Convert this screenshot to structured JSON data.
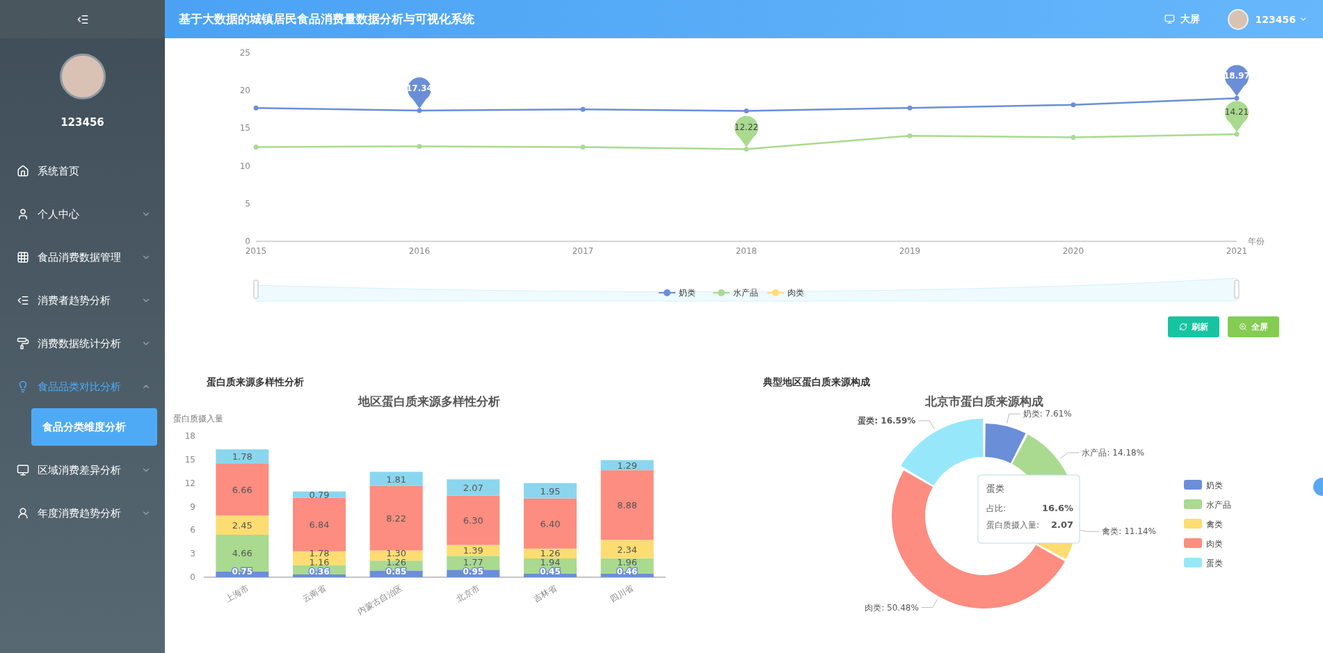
{
  "header": {
    "title": "基于大数据的城镇居民食品消费量数据分析与可视化系统",
    "screen_button": "大屏",
    "user": "123456"
  },
  "sidebar": {
    "username": "123456",
    "items": [
      {
        "label": "系统首页",
        "kind": "link",
        "selected": false
      },
      {
        "label": "个人中心",
        "kind": "submenu",
        "expanded": false,
        "selected": false
      },
      {
        "label": "食品消费数据管理",
        "kind": "submenu",
        "expanded": false,
        "selected": false
      },
      {
        "label": "消费者趋势分析",
        "kind": "submenu",
        "expanded": false,
        "selected": false
      },
      {
        "label": "消费数据统计分析",
        "kind": "submenu",
        "expanded": false,
        "selected": false
      },
      {
        "label": "食品品类对比分析",
        "kind": "submenu",
        "expanded": true,
        "selected": true,
        "children": [
          {
            "label": "食品分类维度分析",
            "selected": true
          }
        ]
      },
      {
        "label": "区域消费差异分析",
        "kind": "submenu",
        "expanded": false,
        "selected": false
      },
      {
        "label": "年度消费趋势分析",
        "kind": "submenu",
        "expanded": false,
        "selected": false
      }
    ]
  },
  "trend_chart": {
    "chart_data": {
      "type": "line",
      "xlabel": "年份",
      "x": [
        "2015",
        "2016",
        "2017",
        "2018",
        "2019",
        "2020",
        "2021"
      ],
      "yticks": [
        0,
        5,
        10,
        15,
        20,
        25
      ],
      "ylim": [
        0,
        25
      ],
      "legend": "bottom",
      "series": [
        {
          "name": "奶类",
          "color": "#6b8ed8",
          "marker": "circle",
          "values": [
            17.7,
            17.34,
            17.5,
            17.3,
            17.7,
            18.1,
            18.97
          ]
        },
        {
          "name": "水产品",
          "color": "#a9da8f",
          "marker": "circle",
          "values": [
            12.5,
            12.6,
            12.5,
            12.22,
            14.0,
            13.8,
            14.21
          ]
        },
        {
          "name": "肉类",
          "color": "#fddd80",
          "marker": "circle",
          "values": [
            null,
            null,
            null,
            null,
            null,
            null,
            null
          ]
        }
      ],
      "annotations": [
        {
          "x": "2016",
          "y": 17.34,
          "text": "17.34"
        },
        {
          "x": "2021",
          "y": 18.97,
          "text": "18.97"
        },
        {
          "x": "2018",
          "y": 12.22,
          "text": "12.22"
        },
        {
          "x": "2021",
          "y": 14.21,
          "text": "14.21"
        }
      ]
    },
    "buttons": [
      {
        "label": "刷新",
        "kind": "refresh"
      },
      {
        "label": "全屏",
        "kind": "fullscreen"
      }
    ]
  },
  "diversity": {
    "heading": "蛋白质来源多样性分析",
    "chart_data": {
      "type": "bar",
      "stacked": true,
      "title": "地区蛋白质来源多样性分析",
      "ylabel": "蛋白质摄入量",
      "yticks": [
        0,
        3,
        6,
        9,
        12,
        15,
        18
      ],
      "ylim": [
        0,
        18
      ],
      "categories": [
        "上海市",
        "云南省",
        "内蒙古自治区",
        "北京市",
        "吉林省",
        "四川省"
      ],
      "series": [
        {
          "color": "#6b8ed8",
          "values": [
            0.75,
            0.36,
            0.85,
            0.95,
            0.45,
            0.46
          ]
        },
        {
          "color": "#a9da8f",
          "values": [
            4.66,
            1.16,
            1.26,
            1.77,
            1.94,
            1.96
          ]
        },
        {
          "color": "#fddd72",
          "values": [
            2.45,
            1.78,
            1.3,
            1.39,
            1.26,
            2.34
          ]
        },
        {
          "color": "#fc8d80",
          "values": [
            6.66,
            6.84,
            8.22,
            6.3,
            6.4,
            8.88
          ]
        },
        {
          "color": "#8ad6ef",
          "values": [
            1.78,
            0.79,
            1.81,
            2.07,
            1.95,
            1.29
          ]
        }
      ],
      "value_labels": [
        [
          "0.75",
          "0.36",
          "0.85",
          "0.95",
          "0.45",
          "0.46"
        ],
        [
          "4.66",
          "1.16",
          "1.26",
          "1.77",
          "1.94",
          "1.96"
        ],
        [
          "2.45",
          "1.78",
          "1.30",
          "1.39",
          "1.26",
          "2.34"
        ],
        [
          "6.66",
          "6.84",
          "8.22",
          "6.30",
          "6.40",
          "8.88"
        ],
        [
          "1.78",
          "0.79",
          "1.81",
          "2.07",
          "1.95",
          "1.29"
        ]
      ]
    }
  },
  "composition": {
    "heading": "典型地区蛋白质来源构成",
    "chart_data": {
      "type": "donut",
      "title": "北京市蛋白质来源构成",
      "categories": [
        "奶类",
        "水产品",
        "禽类",
        "肉类",
        "蛋类"
      ],
      "legend": "right",
      "values": [
        7.61,
        14.18,
        11.14,
        50.48,
        16.59
      ],
      "value_labels": [
        "奶类: 7.61%",
        "水产品: 14.18%",
        "禽类: 11.14%",
        "肉类: 50.48%",
        "蛋类: 16.59%"
      ]
    },
    "slices": [
      {
        "color": "#6b8ed8",
        "emphasized": false
      },
      {
        "color": "#a9da8f",
        "emphasized": false
      },
      {
        "color": "#fddd72",
        "emphasized": false
      },
      {
        "color": "#fc8d80",
        "emphasized": false
      },
      {
        "color": "#97e7fb",
        "emphasized": true
      }
    ],
    "tooltip": {
      "title": "蛋类",
      "rows": [
        {
          "label": "占比:",
          "value": "16.6%"
        },
        {
          "label": "蛋白质摄入量:",
          "value": "2.07"
        }
      ]
    }
  }
}
